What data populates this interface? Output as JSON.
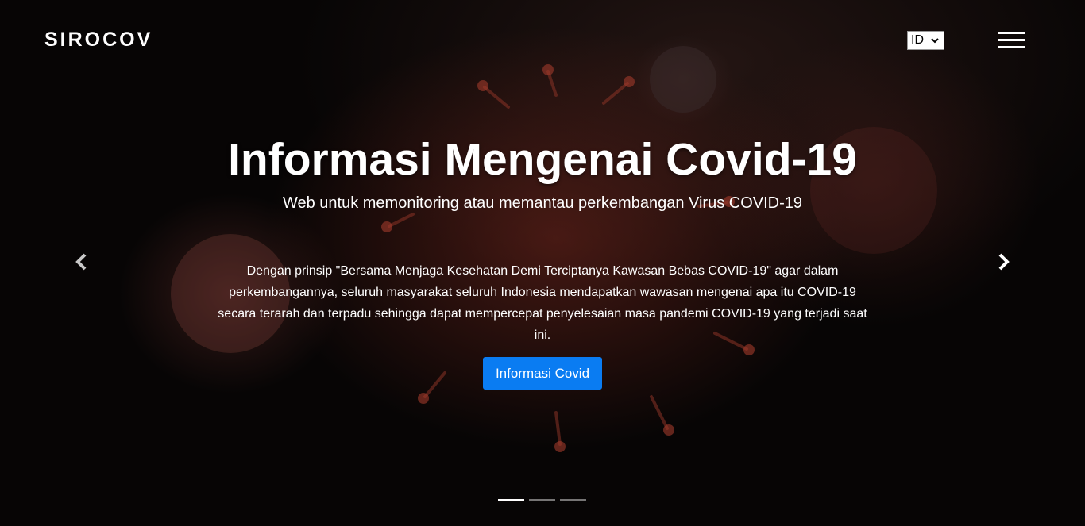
{
  "navbar": {
    "brand": "SIROCOV",
    "language": {
      "selected": "ID"
    },
    "menu_icon": "hamburger-menu-icon"
  },
  "hero": {
    "title": "Informasi Mengenai Covid-19",
    "subtitle": "Web untuk memonitoring atau memantau perkembangan Virus COVID-19",
    "description": "Dengan prinsip \"Bersama Menjaga Kesehatan Demi Terciptanya Kawasan Bebas COVID-19\" agar dalam perkembangannya, seluruh masyarakat seluruh Indonesia mendapatkan wawasan mengenai apa itu COVID-19 secara terarah dan terpadu sehingga dapat mempercepat penyelesaian masa pandemi COVID-19 yang terjadi saat ini.",
    "cta_label": "Informasi Covid",
    "prev_icon": "chevron-left-icon",
    "next_icon": "chevron-right-icon"
  },
  "carousel": {
    "slides": 3,
    "active_index": 0
  },
  "colors": {
    "primary_button": "#0a7cf2",
    "text": "#ffffff",
    "background": "#070505"
  }
}
